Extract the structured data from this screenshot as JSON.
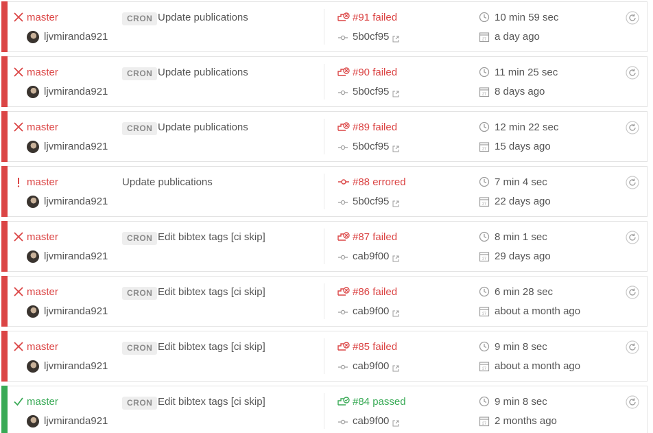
{
  "colors": {
    "failed": "#db4545",
    "errored": "#db4545",
    "passed": "#39aa56",
    "icon_gray": "#9d9d9d"
  },
  "builds": [
    {
      "state": "failed",
      "status_icon": "x-icon",
      "branch": "master",
      "author": "ljvmiranda921",
      "cron": "CRON",
      "message": "Update publications",
      "build_icon": "build-failed-icon",
      "build": "#91 failed",
      "commit": "5b0cf95",
      "duration": "10 min 59 sec",
      "ago": "a day ago"
    },
    {
      "state": "failed",
      "status_icon": "x-icon",
      "branch": "master",
      "author": "ljvmiranda921",
      "cron": "CRON",
      "message": "Update publications",
      "build_icon": "build-failed-icon",
      "build": "#90 failed",
      "commit": "5b0cf95",
      "duration": "11 min 25 sec",
      "ago": "8 days ago"
    },
    {
      "state": "failed",
      "status_icon": "x-icon",
      "branch": "master",
      "author": "ljvmiranda921",
      "cron": "CRON",
      "message": "Update publications",
      "build_icon": "build-failed-icon",
      "build": "#89 failed",
      "commit": "5b0cf95",
      "duration": "12 min 22 sec",
      "ago": "15 days ago"
    },
    {
      "state": "errored",
      "status_icon": "exclamation-icon",
      "branch": "master",
      "author": "ljvmiranda921",
      "cron": "",
      "message": "Update publications",
      "build_icon": "commit-dot-icon",
      "build": "#88 errored",
      "commit": "5b0cf95",
      "duration": "7 min 4 sec",
      "ago": "22 days ago"
    },
    {
      "state": "failed",
      "status_icon": "x-icon",
      "branch": "master",
      "author": "ljvmiranda921",
      "cron": "CRON",
      "message": "Edit bibtex tags [ci skip]",
      "build_icon": "build-failed-icon",
      "build": "#87 failed",
      "commit": "cab9f00",
      "duration": "8 min 1 sec",
      "ago": "29 days ago"
    },
    {
      "state": "failed",
      "status_icon": "x-icon",
      "branch": "master",
      "author": "ljvmiranda921",
      "cron": "CRON",
      "message": "Edit bibtex tags [ci skip]",
      "build_icon": "build-failed-icon",
      "build": "#86 failed",
      "commit": "cab9f00",
      "duration": "6 min 28 sec",
      "ago": "about a month ago"
    },
    {
      "state": "failed",
      "status_icon": "x-icon",
      "branch": "master",
      "author": "ljvmiranda921",
      "cron": "CRON",
      "message": "Edit bibtex tags [ci skip]",
      "build_icon": "build-failed-icon",
      "build": "#85 failed",
      "commit": "cab9f00",
      "duration": "9 min 8 sec",
      "ago": "about a month ago"
    },
    {
      "state": "passed",
      "status_icon": "check-icon",
      "branch": "master",
      "author": "ljvmiranda921",
      "cron": "CRON",
      "message": "Edit bibtex tags [ci skip]",
      "build_icon": "build-passed-icon",
      "build": "#84 passed",
      "commit": "cab9f00",
      "duration": "9 min 8 sec",
      "ago": "2 months ago"
    }
  ]
}
